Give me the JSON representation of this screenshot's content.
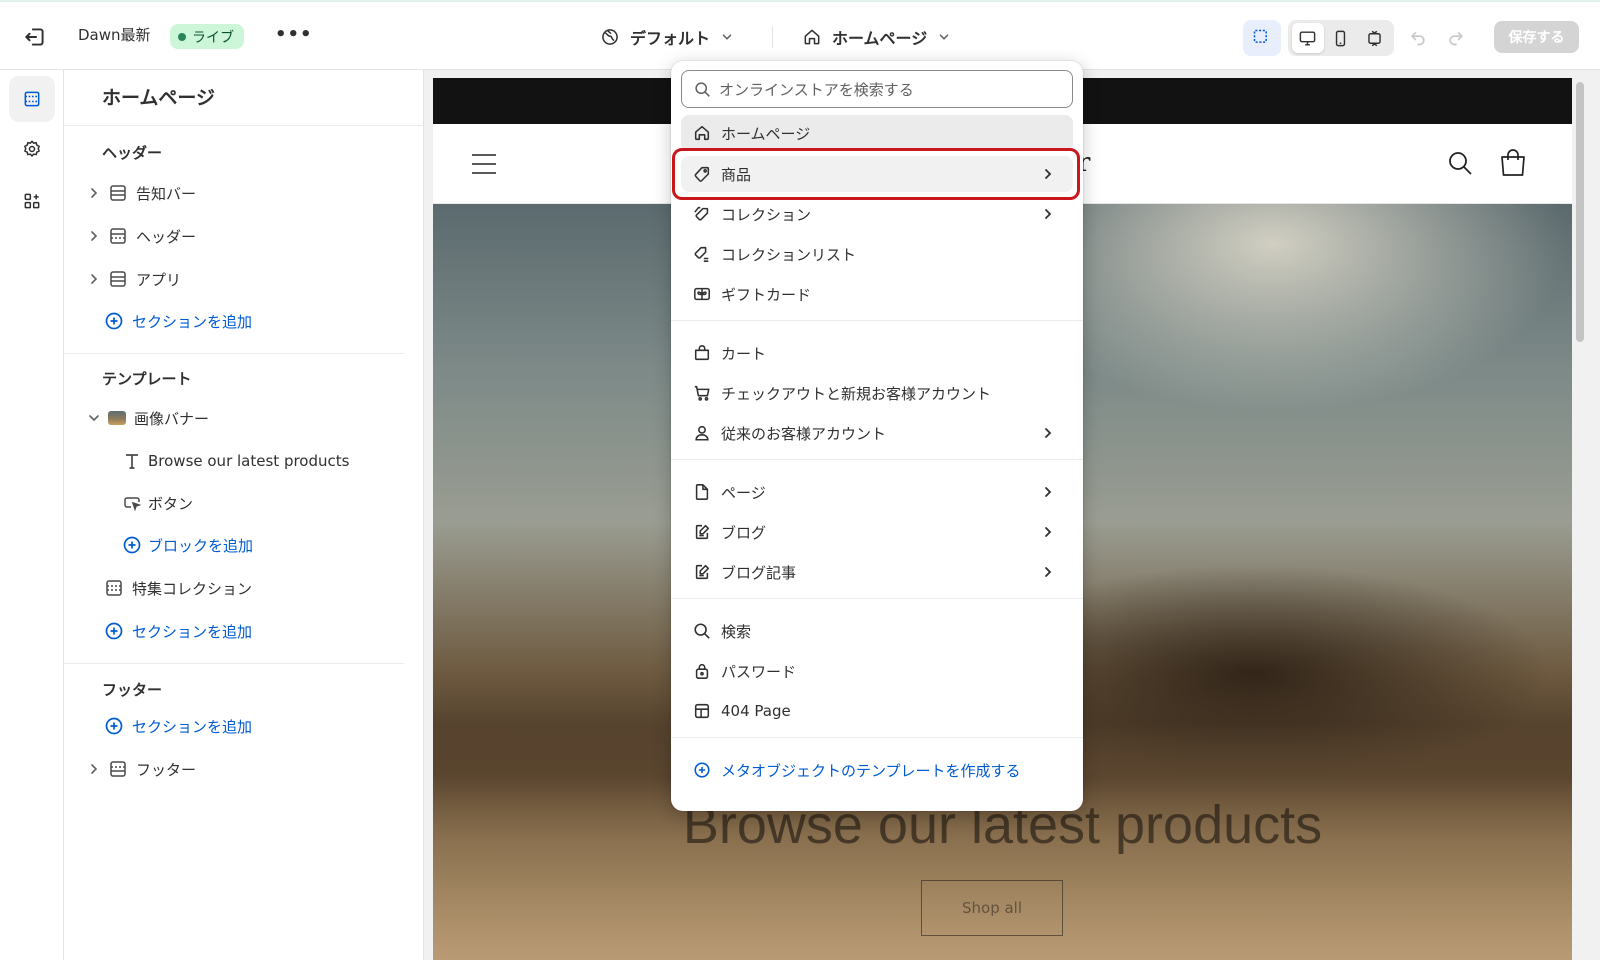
{
  "topbar": {
    "store_name": "Dawn最新",
    "live_label": "ライブ",
    "more_label": "•••",
    "theme_label": "デフォルト",
    "page_label": "ホームページ",
    "save_label": "保存する"
  },
  "panel": {
    "title": "ホームページ",
    "header_group": {
      "title": "ヘッダー",
      "items": [
        "告知バー",
        "ヘッダー",
        "アプリ"
      ],
      "add_section": "セクションを追加"
    },
    "template_group": {
      "title": "テンプレート",
      "banner": "画像バナー",
      "banner_children": [
        "Browse our latest products",
        "ボタン"
      ],
      "add_block": "ブロックを追加",
      "featured": "特集コレクション",
      "add_section": "セクションを追加"
    },
    "footer_group": {
      "title": "フッター",
      "add_section": "セクションを追加",
      "footer_item": "フッター"
    }
  },
  "preview": {
    "logo_fragment": "r",
    "hero_title": "Browse our latest products",
    "hero_button": "Shop all"
  },
  "dropdown": {
    "search_placeholder": "オンラインストアを検索する",
    "items": [
      {
        "label": "ホームページ",
        "icon": "home-icon"
      },
      {
        "label": "商品",
        "icon": "tag-icon"
      },
      {
        "label": "コレクション",
        "icon": "collection-tag-icon"
      },
      {
        "label": "コレクションリスト",
        "icon": "collection-list-icon"
      },
      {
        "label": "ギフトカード",
        "icon": "gift-card-icon"
      },
      {
        "label": "カート",
        "icon": "bag-icon"
      },
      {
        "label": "チェックアウトと新規お客様アカウント",
        "icon": "cart-icon"
      },
      {
        "label": "従来のお客様アカウント",
        "icon": "person-icon"
      },
      {
        "label": "ページ",
        "icon": "page-icon"
      },
      {
        "label": "ブログ",
        "icon": "blog-icon"
      },
      {
        "label": "ブログ記事",
        "icon": "blog-post-icon"
      },
      {
        "label": "検索",
        "icon": "search-icon"
      },
      {
        "label": "パスワード",
        "icon": "lock-icon"
      },
      {
        "label": "404 Page",
        "icon": "layout-icon"
      }
    ],
    "create_label": "メタオブジェクトのテンプレートを作成する"
  },
  "colors": {
    "accent": "#005bd3",
    "highlight_ring": "#c8181e",
    "live_badge_bg": "#cdf6d8"
  }
}
